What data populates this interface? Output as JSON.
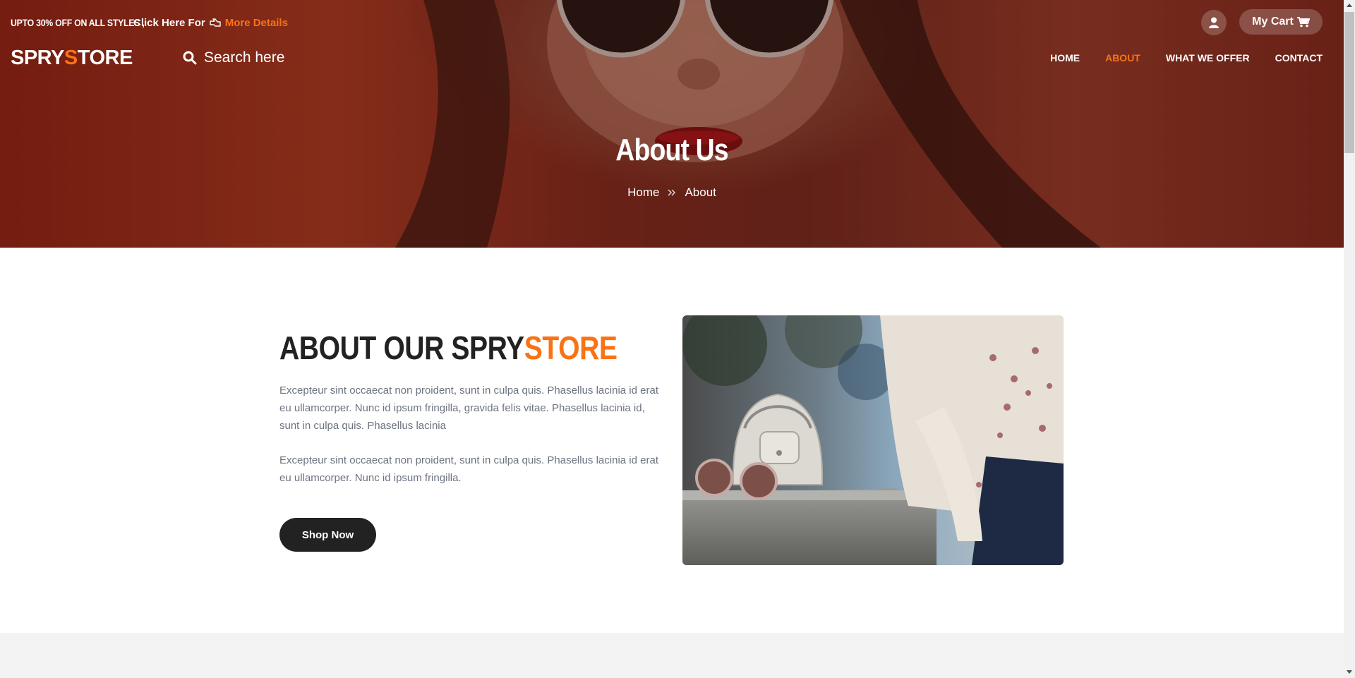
{
  "promo": {
    "headline": "UPTO 30% OFF ON ALL STYLES ,",
    "text": "Click Here For",
    "link": "More Details"
  },
  "header": {
    "logo_part1": "SPRY",
    "logo_accent": "S",
    "logo_part2": "TORE",
    "search_placeholder": "Search here",
    "cart_label": "My Cart",
    "nav": [
      {
        "label": "HOME",
        "active": false
      },
      {
        "label": "ABOUT",
        "active": true
      },
      {
        "label": "WHAT WE OFFER",
        "active": false
      },
      {
        "label": "CONTACT",
        "active": false
      }
    ]
  },
  "hero": {
    "title": "About Us",
    "breadcrumb": [
      "Home",
      "About"
    ]
  },
  "about": {
    "title_main": "ABOUT OUR SPRY",
    "title_accent": "STORE",
    "paragraphs": [
      "Excepteur sint occaecat non proident, sunt in culpa quis. Phasellus lacinia id erat eu ullamcorper. Nunc id ipsum fringilla, gravida felis vitae. Phasellus lacinia id, sunt in culpa quis. Phasellus lacinia",
      "Excepteur sint occaecat non proident, sunt in culpa quis. Phasellus lacinia id erat eu ullamcorper. Nunc id ipsum fringilla."
    ],
    "button": "Shop Now"
  },
  "colors": {
    "accent": "#f97316",
    "dark": "#222222",
    "text_muted": "#6b7280"
  },
  "icons": [
    "hand-pointer-icon",
    "user-icon",
    "cart-icon",
    "search-icon",
    "double-chevron-right-icon"
  ]
}
